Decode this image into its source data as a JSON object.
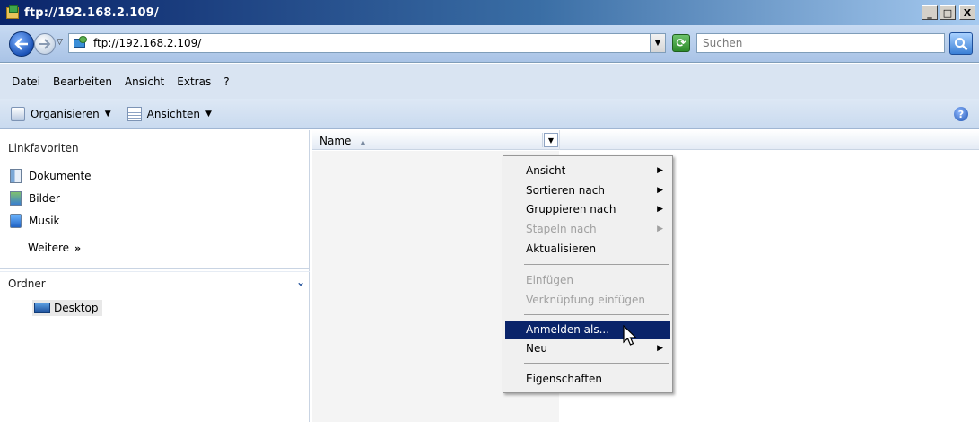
{
  "window": {
    "title": "ftp://192.168.2.109/",
    "buttons": {
      "minimize": "_",
      "maximize": "□",
      "close": "X"
    }
  },
  "address_bar": {
    "address": "ftp://192.168.2.109/",
    "search_placeholder": "Suchen"
  },
  "menu_bar": {
    "items": [
      "Datei",
      "Bearbeiten",
      "Ansicht",
      "Extras",
      "?"
    ]
  },
  "toolbar": {
    "organize_label": "Organisieren",
    "views_label": "Ansichten"
  },
  "nav_pane": {
    "favorites_title": "Linkfavoriten",
    "favorites": [
      "Dokumente",
      "Bilder",
      "Musik"
    ],
    "more_label": "Weitere",
    "folders_title": "Ordner",
    "tree_item": "Desktop"
  },
  "file_list": {
    "column_name": "Name"
  },
  "context_menu": {
    "items": [
      {
        "label": "Ansicht",
        "submenu": true,
        "disabled": false
      },
      {
        "label": "Sortieren nach",
        "submenu": true,
        "disabled": false
      },
      {
        "label": "Gruppieren nach",
        "submenu": true,
        "disabled": false
      },
      {
        "label": "Stapeln nach",
        "submenu": true,
        "disabled": true
      },
      {
        "label": "Aktualisieren",
        "submenu": false,
        "disabled": false
      },
      {
        "label": "Einfügen",
        "submenu": false,
        "disabled": true
      },
      {
        "label": "Verknüpfung einfügen",
        "submenu": false,
        "disabled": true
      },
      {
        "label": "Anmelden als...",
        "submenu": false,
        "disabled": false,
        "highlighted": true
      },
      {
        "label": "Neu",
        "submenu": true,
        "disabled": false
      },
      {
        "label": "Eigenschaften",
        "submenu": false,
        "disabled": false
      }
    ]
  },
  "colors": {
    "title_bar": "#0a246a",
    "menu_highlight": "#0a246a",
    "nav_background": "#d9e4f2"
  }
}
